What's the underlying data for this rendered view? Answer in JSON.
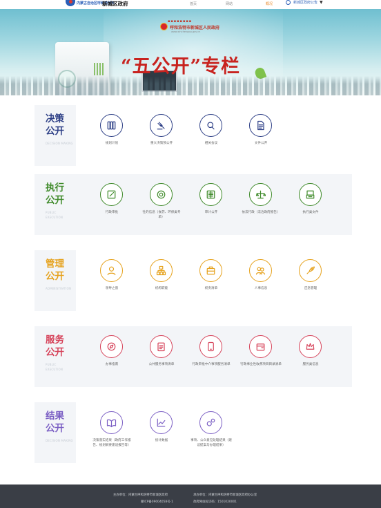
{
  "header": {
    "logo_small": "内蒙古自治区呼和浩特市",
    "logo_text": "新城区政府",
    "nav": [
      "首页",
      "网站",
      "概况"
    ],
    "active_nav_index": 2,
    "user_label": "新城区政府公告"
  },
  "banner": {
    "org_name": "呼和浩特市新城区人民政府",
    "url": "www.xinchengqu.gov.cn",
    "title": "“五公开”专栏"
  },
  "sections": [
    {
      "title_line1": "决策",
      "title_line2": "公开",
      "english": "DECISION MAKING",
      "color": "#2d3f86",
      "shaded": false,
      "items": [
        {
          "label": "规划计划",
          "icon": "book-icon"
        },
        {
          "label": "重大决策预公开",
          "icon": "gavel-icon"
        },
        {
          "label": "相关会议",
          "icon": "chat-bubbles-icon"
        },
        {
          "label": "文件公开",
          "icon": "document-icon"
        }
      ]
    },
    {
      "title_line1": "执行",
      "title_line2": "公开",
      "english": "PUBLIC EXECUTION",
      "color": "#3f8a2a",
      "shaded": true,
      "items": [
        {
          "label": "行政审批",
          "icon": "edit-icon"
        },
        {
          "label": "社的信息（食药、环保类专单）",
          "icon": "badge-icon"
        },
        {
          "label": "审计公开",
          "icon": "ledger-icon"
        },
        {
          "label": "依法行政（法治政府报告）",
          "icon": "scales-icon"
        },
        {
          "label": "执行类文件",
          "icon": "file-print-icon"
        }
      ]
    },
    {
      "title_line1": "管理",
      "title_line2": "公开",
      "english": "ADMINISTRATION",
      "color": "#e6a21d",
      "shaded": false,
      "items": [
        {
          "label": "领导之窗",
          "icon": "person-icon"
        },
        {
          "label": "机构职能",
          "icon": "org-chart-icon"
        },
        {
          "label": "权责清单",
          "icon": "briefcase-icon"
        },
        {
          "label": "人事信息",
          "icon": "people-icon"
        },
        {
          "label": "应急管理",
          "icon": "rocket-icon"
        }
      ]
    },
    {
      "title_line1": "服务",
      "title_line2": "公开",
      "english": "PUBLIC EXECUTION",
      "color": "#d6435a",
      "shaded": true,
      "items": [
        {
          "label": "办事指南",
          "icon": "compass-icon"
        },
        {
          "label": "公共服务事项清单",
          "icon": "checklist-icon"
        },
        {
          "label": "行政审批中介事项服务清单",
          "icon": "phone-icon"
        },
        {
          "label": "行政事业性收费项目目录清单",
          "icon": "wallet-icon"
        },
        {
          "label": "服务类信息",
          "icon": "crown-icon"
        }
      ]
    },
    {
      "title_line1": "结果",
      "title_line2": "公开",
      "english": "DECISION MAKING",
      "color": "#7b5fc4",
      "shaded": false,
      "items": [
        {
          "label": "决策落实结果（政府工作报告、规划纲要建设报告等）",
          "icon": "open-book-icon"
        },
        {
          "label": "统计数据",
          "icon": "line-chart-icon"
        },
        {
          "label": "事项、公众意见处理结果（建议提案与办理结果）",
          "icon": "link-icon"
        }
      ]
    }
  ],
  "footer": {
    "sponsor": "主办单位：内蒙古呼和浩特市新城区政府",
    "organizer": "承办单位：内蒙古呼和浩特市新城区政府办公室",
    "icp": "蒙ICP备09004058号-1",
    "site_code": "政府网站标识码：1501020001"
  }
}
